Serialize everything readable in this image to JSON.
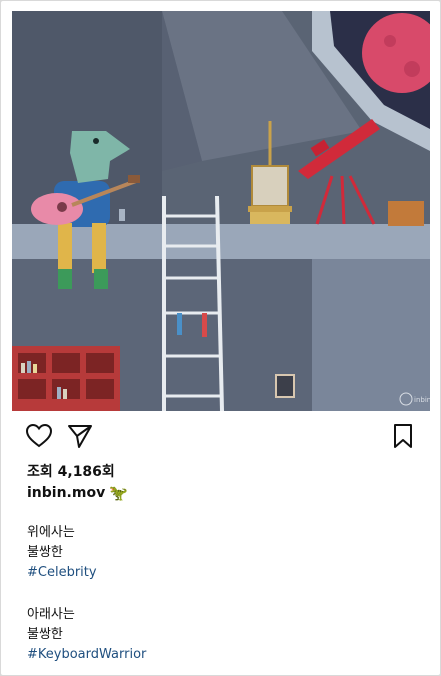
{
  "post": {
    "views_label": "조회 4,186회",
    "author": "inbin.mov",
    "author_emoji": "🦖",
    "caption_lines": [
      "위에사는",
      "불쌍한",
      "#Celebrity",
      "아래사는",
      "불쌍한",
      "#KeyboardWarrior"
    ],
    "hashtag_color": "#1f4f7f",
    "watermark": "inbin"
  },
  "icons": {
    "like": "heart-icon",
    "share": "paper-plane-icon",
    "save": "bookmark-icon"
  }
}
